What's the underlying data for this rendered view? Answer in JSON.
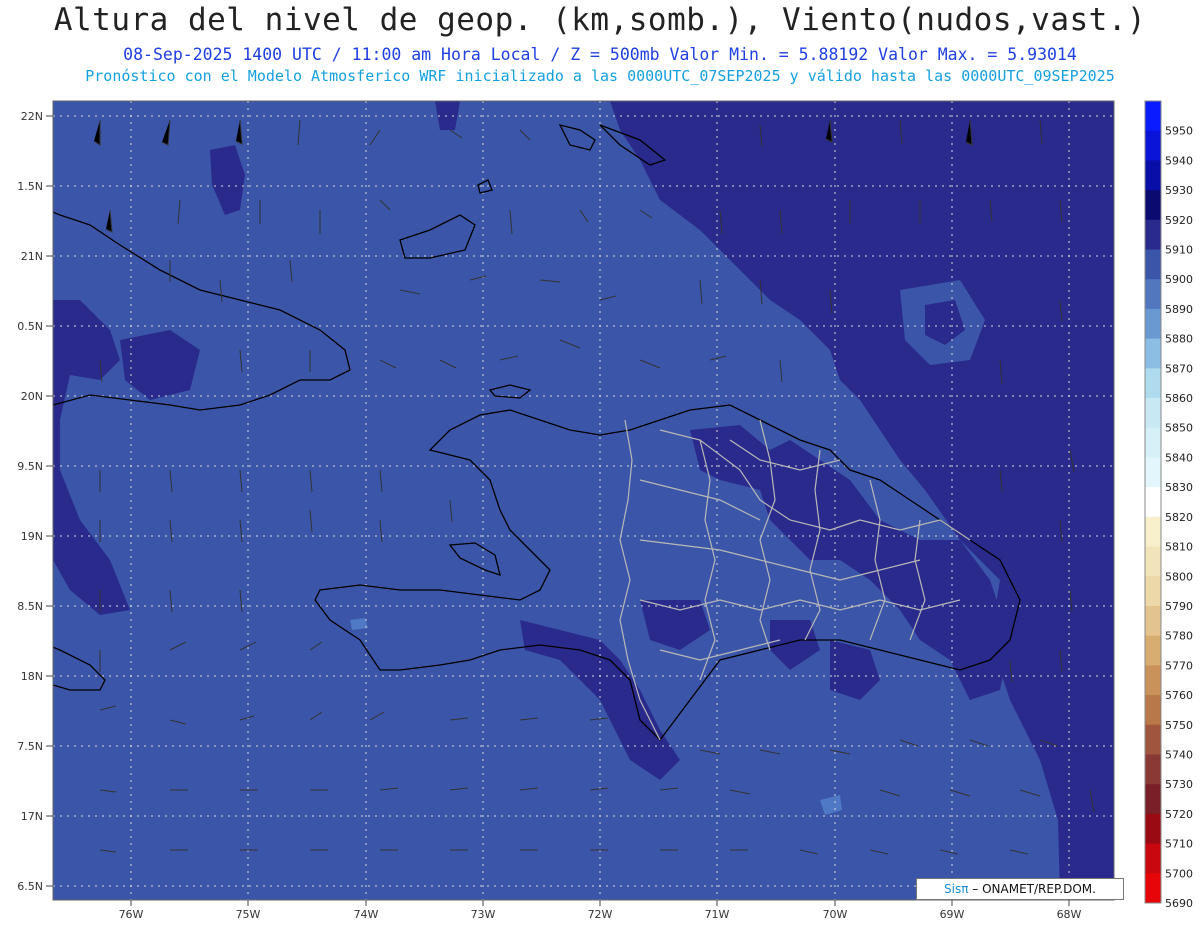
{
  "header": {
    "title": "Altura del nivel de geop. (km,somb.), Viento(nudos,vast.)",
    "line2": "08-Sep-2025  1400 UTC / 11:00 am Hora Local / Z = 500mb    Valor Min. = 5.88192  Valor Max. = 5.93014",
    "line3": "Pronóstico con el Modelo Atmosferico WRF inicializado a las 0000UTC_07SEP2025 y válido hasta las  0000UTC_09SEP2025"
  },
  "map": {
    "lat_labels": [
      "22N",
      "1.5N",
      "21N",
      "0.5N",
      "20N",
      "9.5N",
      "19N",
      "8.5N",
      "18N",
      "7.5N",
      "17N",
      "6.5N"
    ],
    "lon_labels": [
      "76W",
      "75W",
      "74W",
      "73W",
      "72W",
      "71W",
      "70W",
      "69W",
      "68W"
    ],
    "colors": {
      "field_5900": "#3b56a8",
      "field_5910": "#2a2a8c",
      "field_5890": "#4f79c4",
      "coast": "#000000",
      "provinces": "#b8b8b8",
      "grid": "#d8d8d8"
    }
  },
  "colorbar": {
    "levels": [
      "5950",
      "5940",
      "5930",
      "5920",
      "5910",
      "5900",
      "5890",
      "5880",
      "5870",
      "5860",
      "5850",
      "5840",
      "5830",
      "5820",
      "5810",
      "5800",
      "5790",
      "5780",
      "5770",
      "5760",
      "5750",
      "5740",
      "5730",
      "5720",
      "5710",
      "5700",
      "5690"
    ],
    "colors": [
      "#0a1cff",
      "#0a14d8",
      "#0a0ea8",
      "#0a0a70",
      "#2a2a8c",
      "#3b56a8",
      "#5277bf",
      "#6a98d0",
      "#8cbde3",
      "#b0dbee",
      "#c8e9f4",
      "#d6f0f8",
      "#e2f6fb",
      "#ffffff",
      "#f8efcc",
      "#f1e4bb",
      "#ecd8a8",
      "#e3c48e",
      "#d7ad72",
      "#c9925a",
      "#b8784a",
      "#a0563e",
      "#8a3a35",
      "#7a1f28",
      "#9a0a12",
      "#c8080e",
      "#e6060a"
    ]
  },
  "credit": {
    "brand": "Sisπ",
    "org": "– ONAMET/REP.DOM."
  }
}
